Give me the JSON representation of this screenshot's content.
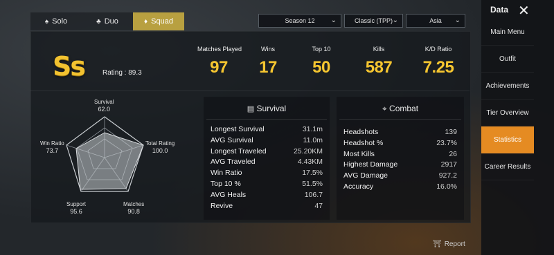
{
  "tabs": [
    {
      "label": "Solo",
      "icon": "person-icon"
    },
    {
      "label": "Duo",
      "icon": "duo-icon"
    },
    {
      "label": "Squad",
      "icon": "squad-icon"
    }
  ],
  "filters": {
    "season": "Season 12",
    "mode": "Classic (TPP)",
    "region": "Asia"
  },
  "rating": {
    "tier": "Ss",
    "label": "Rating : 89.3"
  },
  "summary": [
    {
      "label": "Matches Played",
      "value": "97"
    },
    {
      "label": "Wins",
      "value": "17"
    },
    {
      "label": "Top 10",
      "value": "50"
    },
    {
      "label": "Kills",
      "value": "587"
    },
    {
      "label": "K/D Ratio",
      "value": "7.25"
    }
  ],
  "radar": {
    "survival": {
      "label": "Survival",
      "value": "62.0"
    },
    "total_rating": {
      "label": "Total Rating",
      "value": "100.0"
    },
    "matches": {
      "label": "Matches",
      "value": "90.8"
    },
    "support": {
      "label": "Support",
      "value": "95.6"
    },
    "win_ratio": {
      "label": "Win Ratio",
      "value": "73.7"
    }
  },
  "survival_box": {
    "title": "Survival",
    "rows": [
      {
        "label": "Longest Survival",
        "value": "31.1m"
      },
      {
        "label": "AVG Survival",
        "value": "11.0m"
      },
      {
        "label": "Longest Traveled",
        "value": "25.20KM"
      },
      {
        "label": "AVG Traveled",
        "value": "4.43KM"
      },
      {
        "label": "Win Ratio",
        "value": "17.5%"
      },
      {
        "label": "Top 10 %",
        "value": "51.5%"
      },
      {
        "label": "AVG Heals",
        "value": "106.7"
      },
      {
        "label": "Revive",
        "value": "47"
      }
    ]
  },
  "combat_box": {
    "title": "Combat",
    "rows": [
      {
        "label": "Headshots",
        "value": "139"
      },
      {
        "label": "Headshot %",
        "value": "23.7%"
      },
      {
        "label": "Most Kills",
        "value": "26"
      },
      {
        "label": "Highest Damage",
        "value": "2917"
      },
      {
        "label": "AVG Damage",
        "value": "927.2"
      },
      {
        "label": "Accuracy",
        "value": "16.0%"
      }
    ]
  },
  "sidebar": {
    "title": "Data",
    "items": [
      {
        "label": "Main Menu"
      },
      {
        "label": "Outfit"
      },
      {
        "label": "Achievements"
      },
      {
        "label": "Tier Overview"
      },
      {
        "label": "Statistics"
      },
      {
        "label": "Career Results"
      }
    ]
  },
  "report_label": "Report",
  "colors": {
    "accent": "#e58b22",
    "gold": "#f6c630",
    "tab_active": "#b8a040"
  }
}
